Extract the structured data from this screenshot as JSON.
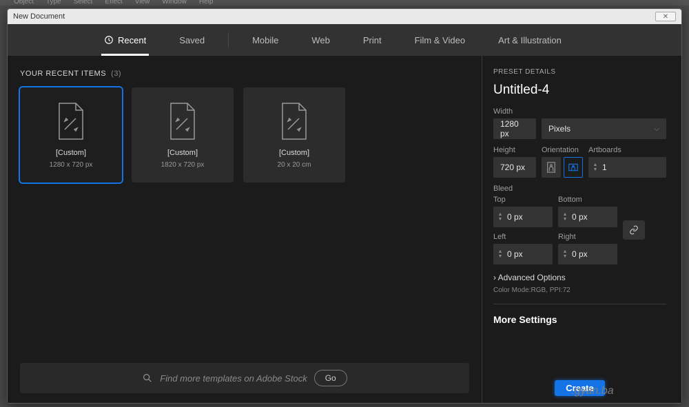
{
  "app_menu": [
    "Object",
    "Type",
    "Select",
    "Effect",
    "View",
    "Window",
    "Help"
  ],
  "dialog": {
    "title": "New Document",
    "tabs": [
      "Recent",
      "Saved",
      "Mobile",
      "Web",
      "Print",
      "Film & Video",
      "Art & Illustration"
    ],
    "active_tab": 0,
    "section_title": "YOUR RECENT ITEMS",
    "recent_count": "(3)",
    "presets": [
      {
        "name": "[Custom]",
        "dims": "1280 x 720 px",
        "selected": true
      },
      {
        "name": "[Custom]",
        "dims": "1820 x 720 px",
        "selected": false
      },
      {
        "name": "[Custom]",
        "dims": "20 x 20 cm",
        "selected": false
      }
    ],
    "search_placeholder": "Find more templates on Adobe Stock",
    "go_label": "Go"
  },
  "details": {
    "panel_title": "PRESET DETAILS",
    "doc_name": "Untitled-4",
    "labels": {
      "width": "Width",
      "height": "Height",
      "orientation": "Orientation",
      "artboards": "Artboards",
      "bleed": "Bleed",
      "top": "Top",
      "bottom": "Bottom",
      "left": "Left",
      "right": "Right",
      "advanced": "Advanced Options",
      "more": "More Settings"
    },
    "width_value": "1280 px",
    "units": "Pixels",
    "height_value": "720 px",
    "artboards_value": "1",
    "bleed": {
      "top": "0 px",
      "bottom": "0 px",
      "left": "0 px",
      "right": "0 px"
    },
    "mode_line": "Color Mode:RGB, PPI:72",
    "create_label": "Create",
    "watermark": ".gyan.ba"
  }
}
